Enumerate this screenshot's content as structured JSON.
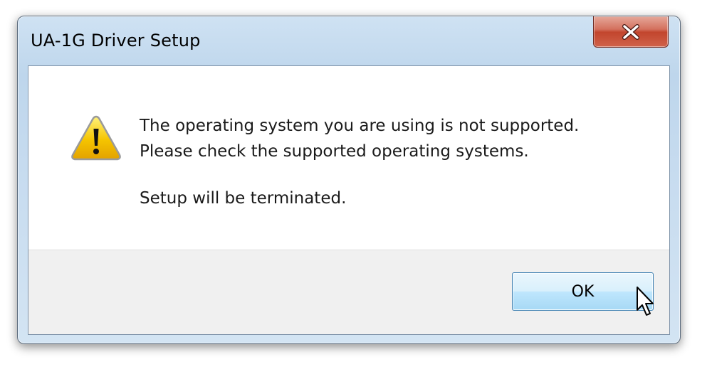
{
  "window": {
    "title": "UA-1G Driver Setup",
    "close_icon": "close-icon"
  },
  "dialog": {
    "icon": "warning-icon",
    "message_line1": "The operating system you are using is not supported.",
    "message_line2": "Please check the supported operating systems.",
    "message_line3": "Setup will be terminated."
  },
  "buttons": {
    "ok_label": "OK"
  },
  "colors": {
    "close_red": "#c2452d",
    "ok_blue": "#bee6fd",
    "warning_yellow": "#f5c400",
    "button_area_gray": "#f0f0f0"
  }
}
